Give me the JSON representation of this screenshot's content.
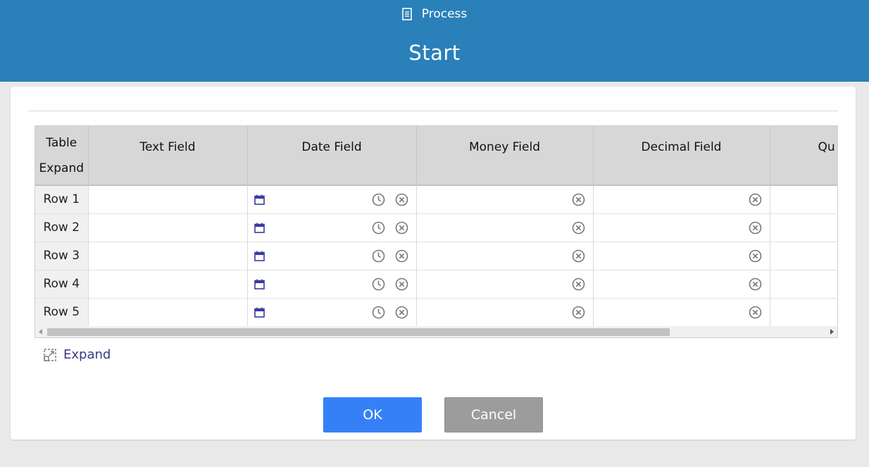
{
  "header": {
    "process_label": "Process",
    "title": "Start",
    "background": "#2a80b9",
    "process_icon": "document-icon"
  },
  "table": {
    "columns": [
      "Table Expand",
      "Text Field",
      "Date Field",
      "Money Field",
      "Decimal Field",
      "Qu"
    ],
    "rows": [
      {
        "label": "Row 1",
        "text": "",
        "date": "",
        "money": "",
        "decimal": ""
      },
      {
        "label": "Row 2",
        "text": "",
        "date": "",
        "money": "",
        "decimal": ""
      },
      {
        "label": "Row 3",
        "text": "",
        "date": "",
        "money": "",
        "decimal": ""
      },
      {
        "label": "Row 4",
        "text": "",
        "date": "",
        "money": "",
        "decimal": ""
      },
      {
        "label": "Row 5",
        "text": "",
        "date": "",
        "money": "",
        "decimal": ""
      }
    ],
    "icons": {
      "date": "calendar-icon",
      "time": "clock-icon",
      "clear": "clear-icon"
    }
  },
  "expand": {
    "label": "Expand",
    "icon": "expand-icon"
  },
  "buttons": {
    "ok_label": "OK",
    "cancel_label": "Cancel",
    "ok_color": "#3680f7",
    "cancel_color": "#9c9c9c"
  }
}
